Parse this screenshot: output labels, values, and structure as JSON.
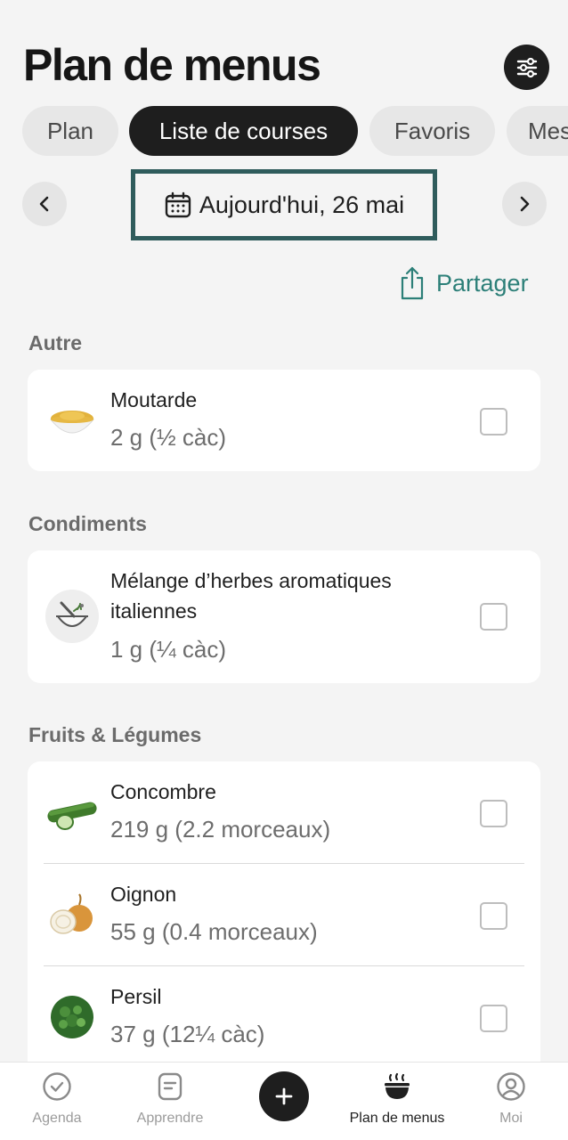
{
  "header": {
    "title": "Plan de menus",
    "settings_icon": "sliders-icon"
  },
  "tabs": [
    {
      "label": "Plan",
      "active": false
    },
    {
      "label": "Liste de courses",
      "active": true
    },
    {
      "label": "Favoris",
      "active": false
    },
    {
      "label": "Mes",
      "active": false
    }
  ],
  "date_nav": {
    "prev_icon": "chevron-left-icon",
    "next_icon": "chevron-right-icon",
    "calendar_icon": "calendar-icon",
    "date_label": "Aujourd'hui, 26 mai"
  },
  "share": {
    "label": "Partager",
    "icon": "share-icon",
    "color": "#2c7f78"
  },
  "sections": [
    {
      "title": "Autre",
      "items": [
        {
          "name": "Moutarde",
          "qty": "2 g (½ càc)",
          "icon": "mustard-bowl-icon",
          "checked": false
        }
      ]
    },
    {
      "title": "Condiments",
      "items": [
        {
          "name_line1": "Mélange d’herbes aromatiques",
          "name_line2": "italiennes",
          "qty": "1 g (¼ càc)",
          "icon": "mortar-herbs-icon",
          "checked": false
        }
      ]
    },
    {
      "title": "Fruits & Légumes",
      "items": [
        {
          "name": "Concombre",
          "qty": "219 g (2.2 morceaux)",
          "icon": "cucumber-icon",
          "checked": false
        },
        {
          "name": "Oignon",
          "qty": "55 g (0.4 morceaux)",
          "icon": "onion-icon",
          "checked": false
        },
        {
          "name": "Persil",
          "qty": "37 g (12¼ càc)",
          "icon": "parsley-icon",
          "checked": false
        }
      ]
    }
  ],
  "bottom_nav": {
    "items": [
      {
        "label": "Agenda",
        "icon": "check-circle-icon",
        "active": false
      },
      {
        "label": "Apprendre",
        "icon": "book-icon",
        "active": false
      },
      {
        "label": "",
        "icon": "plus-icon",
        "active": false
      },
      {
        "label": "Plan de menus",
        "icon": "bowl-icon",
        "active": true
      },
      {
        "label": "Moi",
        "icon": "profile-icon",
        "active": false
      }
    ]
  }
}
